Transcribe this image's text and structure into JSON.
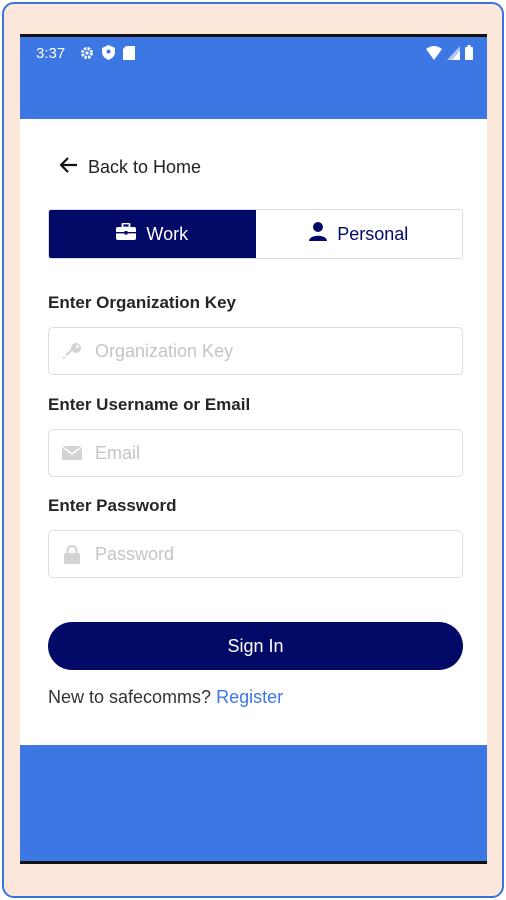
{
  "status": {
    "time": "3:37",
    "left_icons": [
      "gear-icon",
      "shield-icon",
      "sd-card-icon"
    ],
    "right_icons": [
      "wifi-icon",
      "signal-icon",
      "battery-icon"
    ]
  },
  "nav": {
    "back_label": "Back to Home",
    "back_icon": "arrow-left-icon"
  },
  "toggle": {
    "work_label": "Work",
    "work_icon": "briefcase-icon",
    "personal_label": "Personal",
    "personal_icon": "person-icon",
    "selected": "Work"
  },
  "form": {
    "org_label": "Enter Organization Key",
    "org_placeholder": "Organization Key",
    "org_value": "",
    "user_label": "Enter Username or Email",
    "user_placeholder": "Email",
    "user_value": "",
    "password_label": "Enter Password",
    "password_placeholder": "Password",
    "password_value": ""
  },
  "actions": {
    "signin_label": "Sign In"
  },
  "register": {
    "prompt": "New to safecomms?",
    "link": "Register"
  },
  "colors": {
    "primary": "#030966",
    "accent": "#3d77e4",
    "frame": "#fde6da"
  }
}
